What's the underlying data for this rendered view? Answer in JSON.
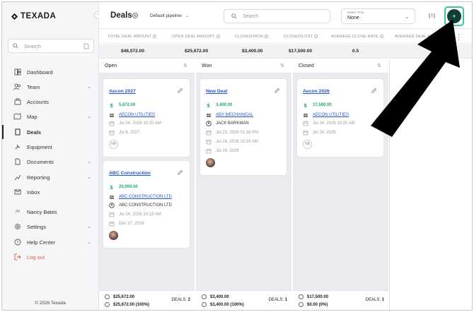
{
  "app": {
    "logo_text": "TEXADA",
    "copyright": "© 2026 Texada"
  },
  "sidebar": {
    "search_placeholder": "Search",
    "items": [
      {
        "label": "Dashboard",
        "icon": "dashboard-icon"
      },
      {
        "label": "Team",
        "icon": "team-icon",
        "expandable": true
      },
      {
        "label": "Accounts",
        "icon": "accounts-icon"
      },
      {
        "label": "Map",
        "icon": "map-icon",
        "expandable": true
      },
      {
        "label": "Deals",
        "icon": "deals-icon",
        "active": true
      },
      {
        "label": "Equipment",
        "icon": "equipment-icon"
      },
      {
        "label": "Documents",
        "icon": "documents-icon",
        "expandable": true
      },
      {
        "label": "Reporting",
        "icon": "reporting-icon",
        "expandable": true
      },
      {
        "label": "Inbox",
        "icon": "inbox-icon"
      },
      {
        "label": "Nancy Bates",
        "icon": "avatar-initials",
        "initials": "JM"
      },
      {
        "label": "Settings",
        "icon": "settings-icon",
        "expandable": true
      },
      {
        "label": "Help Center",
        "icon": "help-icon",
        "expandable": true
      },
      {
        "label": "Log out",
        "icon": "logout-icon"
      }
    ]
  },
  "header": {
    "title": "Deals",
    "pipeline": "Default pipeline",
    "search_placeholder": "Search",
    "time_select": {
      "label": "Select Time",
      "value": "None"
    }
  },
  "stats": {
    "labels": [
      "TOTAL DEAL AMOUNT",
      "OPEN DEAL AMOUNT",
      "CLOSED/WON",
      "CLOSED/LOST",
      "AVERAGE CLOSE RATE",
      "AVERAGE DEAL AM"
    ],
    "values": [
      "$46,572.00",
      "$25,672.00",
      "$3,400.00",
      "$17,500.00",
      "0.5",
      ""
    ]
  },
  "columns": [
    {
      "name": "Open",
      "cards": [
        {
          "title": "Aecon 2027",
          "amount": "5,672.00",
          "company": "AECON UTILITIES",
          "contact": "",
          "created": "Jul 24, 2026 10:20 AM",
          "close": "Jul 8, 2027",
          "owner": "NB"
        },
        {
          "title": "ABC Construction",
          "amount": "20,000.00",
          "company": "ABC CONSTRUCTION LTD",
          "contact": "ABC CONSTRUCTION LTD",
          "created": "Jul 24, 2026 10:19 AM",
          "close": "Dec 17, 2026",
          "owner": ""
        }
      ],
      "footer": {
        "amount": "$25,672.00",
        "weighted": "$25,672.00 (100%)",
        "deals_label": "DEALS:",
        "deals": "2"
      }
    },
    {
      "name": "Won",
      "cards": [
        {
          "title": "New Deal",
          "amount": "3,400.00",
          "company": "ABX MECHANICAL",
          "contact": "JACK BARKMAN",
          "created": "Jul 23, 2026 01:16 PM",
          "modified": "Jul 24, 2026 10:19 AM",
          "close": "Jul 24, 2026",
          "owner": ""
        }
      ],
      "footer": {
        "amount": "$3,400.00",
        "weighted": "$3,400.00 (100%)",
        "deals_label": "DEALS:",
        "deals": "1"
      }
    },
    {
      "name": "Closed",
      "cards": [
        {
          "title": "Aecon 2026",
          "amount": "17,500.00",
          "company": "AECON UTILITIES",
          "contact": "",
          "created": "Jul 24, 2026 10:20 AM",
          "close": "Jul 24, 2026",
          "owner": "NB"
        }
      ],
      "footer": {
        "amount": "$17,500.00",
        "weighted": "$0.00 (0%)",
        "deals_label": "DEALS:",
        "deals": "1"
      }
    }
  ],
  "colors": {
    "accent": "#3fc4a3",
    "add_button": "#0f3e36",
    "link": "#2458c8",
    "amount": "#21a67a",
    "logout": "#e25a4a"
  }
}
